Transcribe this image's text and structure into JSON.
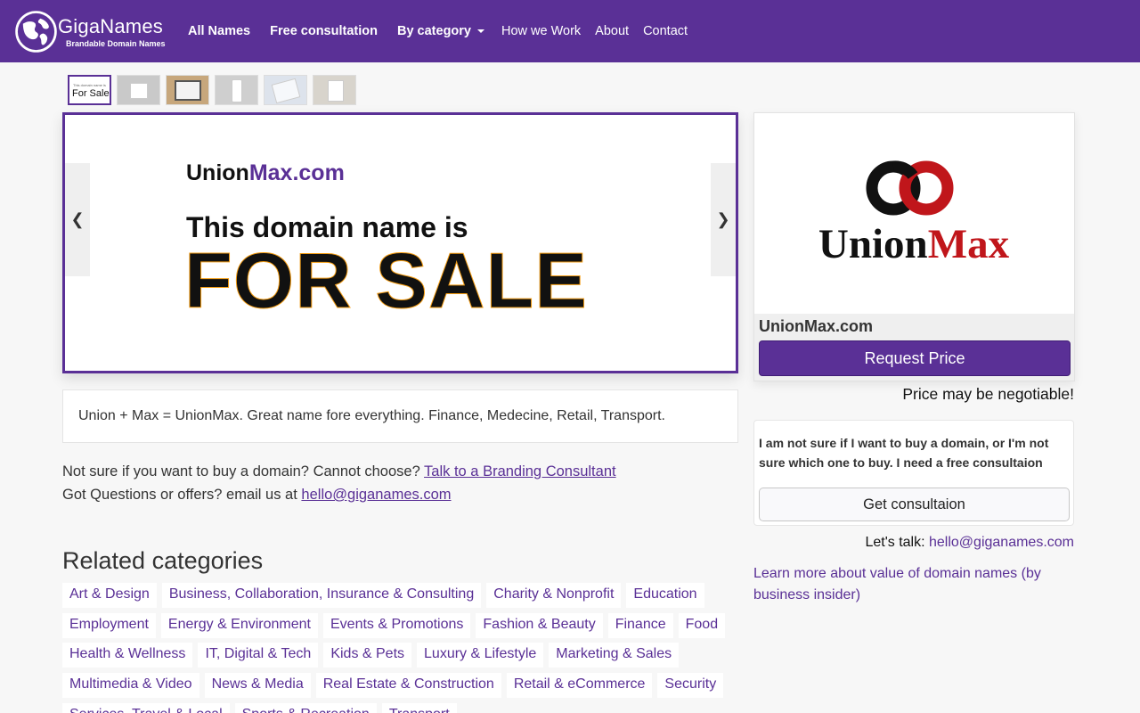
{
  "brand": {
    "name_part1": "Giga",
    "name_part2": "Names",
    "tagline": "Brandable Domain Names"
  },
  "nav": {
    "items": [
      {
        "label": "All Names"
      },
      {
        "label": "Free consultation"
      },
      {
        "label": "By category"
      },
      {
        "label": "How we Work"
      },
      {
        "label": "About"
      },
      {
        "label": "Contact"
      }
    ]
  },
  "thumbnails": {
    "first_small": "This domain name is",
    "first_big": "For Sale"
  },
  "carousel": {
    "prev": "❮",
    "next": "❯",
    "domain_part1": "Union",
    "domain_part2": "Max.com",
    "headline": "This domain name is",
    "for_sale": "FOR SALE"
  },
  "description": "Union + Max = UnionMax. Great name fore everything. Finance, Medecine, Retail, Transport.",
  "info": {
    "line1_text": "Not sure if you want to buy a domain? Cannot choose? ",
    "line1_link": "Talk to a Branding Consultant",
    "line2_text": "Got Questions or offers? email us at ",
    "line2_link": "hello@giganames.com"
  },
  "related": {
    "title": "Related categories",
    "rows": [
      [
        "Art & Design",
        "Business, Collaboration, Insurance & Consulting",
        "Charity & Nonprofit",
        "Education"
      ],
      [
        "Employment",
        "Energy & Environment",
        "Events & Promotions",
        "Fashion & Beauty",
        "Finance",
        "Food"
      ],
      [
        "Health & Wellness",
        "IT, Digital & Tech",
        "Kids & Pets",
        "Luxury & Lifestyle",
        "Marketing & Sales"
      ],
      [
        "Multimedia & Video",
        "News & Media",
        "Real Estate & Construction",
        "Retail & eCommerce",
        "Security"
      ],
      [
        "Services, Travel & Local",
        "Sports & Recreation",
        "Transport"
      ]
    ]
  },
  "card": {
    "logo_part1": "Union",
    "logo_part2": "Max",
    "domain": "UnionMax.com",
    "request_button": "Request Price",
    "negotiable": "Price may be negotiable!"
  },
  "consult": {
    "text": "I am not sure if I want to buy a domain, or I'm not sure which one to buy. I need a free consultaion",
    "button": "Get consultaion"
  },
  "talk": {
    "label": "Let's talk: ",
    "email": "hello@giganames.com"
  },
  "learn_more": "Learn more about value of domain names (by business insider)",
  "colors": {
    "brand_purple": "#5a3096",
    "logo_red": "#c0161b",
    "logo_black": "#111111",
    "for_sale_outline": "#f39c12"
  }
}
